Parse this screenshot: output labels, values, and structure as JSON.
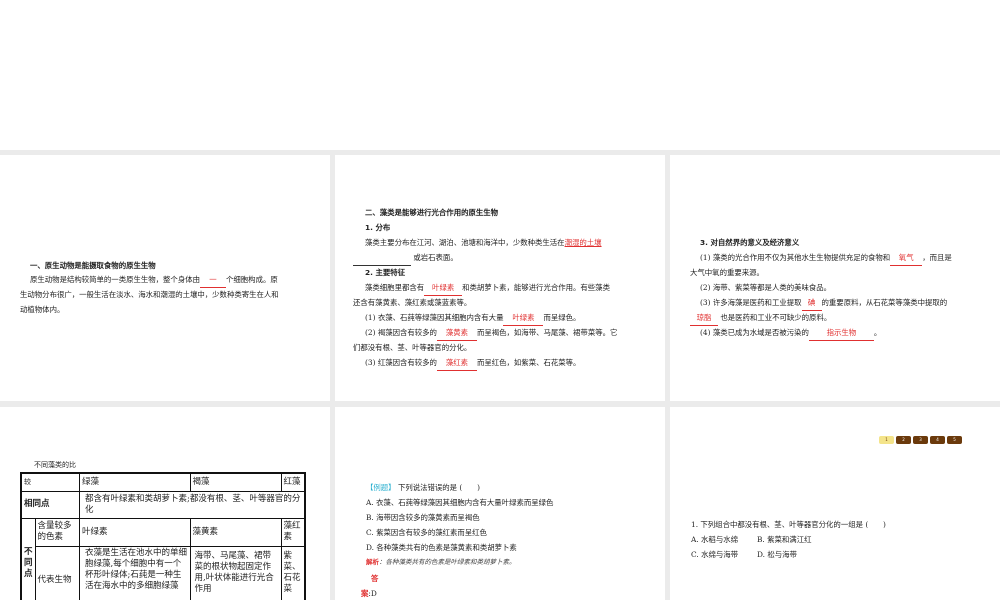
{
  "slide1": {
    "heading": "一、原生动物是能摄取食物的原生生物",
    "line1a": "原生动物是结构较简单的一类原生生物，整个身体由",
    "blank1": "一",
    "line1b": "个细胞构成。原",
    "line2": "生动物分布很广，一般生活在淡水、海水和潮湿的土壤中，少数种类寄生在人和",
    "line3": "动植物体内。"
  },
  "slide2": {
    "heading": "二、藻类是能够进行光合作用的原生生物",
    "sub1": "1. 分布",
    "p1a": "藻类主要分布在江河、湖泊、池塘和海洋中，少数种类生活在",
    "p1ans": "潮湿的土壤",
    "p1b": "或岩石表面。",
    "sub2": "2. 主要特征",
    "p2a": "藻类细胞里都含有",
    "p2ans": "叶绿素",
    "p2b": "和类胡萝卜素，能够进行光合作用。有些藻类",
    "p2c": "还含有藻黄素、藻红素或藻蓝素等。",
    "i1a": "(1) 衣藻、石莼等绿藻因其细胞内含有大量",
    "i1ans": "叶绿素",
    "i1b": "而呈绿色。",
    "i2a": "(2) 褐藻因含有较多的",
    "i2ans": "藻黄素",
    "i2b": "而呈褐色，如海带、马尾藻、裙带菜等。它",
    "i2c": "们都没有根、茎、叶等器官的分化。",
    "i3a": "(3) 红藻因含有较多的",
    "i3ans": "藻红素",
    "i3b": "而呈红色，如紫菜、石花菜等。"
  },
  "slide3": {
    "heading": "3. 对自然界的意义及经济意义",
    "i1a": "(1) 藻类的光合作用不仅为其他水生生物提供充足的食物和",
    "i1ans": "氧气",
    "i1b": "，而且是",
    "i1c": "大气中氧的重要来源。",
    "i2": "(2) 海带、紫菜等都是人类的美味食品。",
    "i3a": "(3) 许多海藻是医药和工业提取",
    "i3ans": "碘",
    "i3b": "的重要原料，从石花菜等藻类中提取的",
    "i3ans2": "琼脂",
    "i3c": "也是医药和工业不可缺少的原料。",
    "i4a": "(4) 藻类已成为水域是否被污染的",
    "i4ans": "指示生物",
    "i4b": "。"
  },
  "slide4": {
    "caption": "不同藻类的比",
    "table": {
      "h0": "较",
      "h1": "绿藻",
      "h2": "褐藻",
      "h3": "红藻",
      "same_label": "相同点",
      "same": "都含有叶绿素和类胡萝卜素;都没有根、茎、叶等器官的分化",
      "diff_label": "不同点",
      "pig_label": "含量较多的色素",
      "pig1": "叶绿素",
      "pig2": "藻黄素",
      "pig3": "藻红素",
      "rep_label": "代表生物",
      "rep1": "衣藻是生活在池水中的单细胞绿藻,每个细胞中有一个杯形叶绿体;石莼是一种生活在海水中的多细胞绿藻",
      "rep2": "海带、马尾藻、裙带菜的根状物起固定作用,叶状体能进行光合作用",
      "rep3": "紫菜、石花菜"
    }
  },
  "slide5": {
    "tag": "【例题】",
    "question": "下列说法错误的是 (　　)",
    "a": "A. 衣藻、石莼等绿藻因其细胞内含有大量叶绿素而呈绿色",
    "b": "B. 海带因含较多的藻黄素而呈褐色",
    "c": "C. 紫菜因含有较多的藻红素而呈红色",
    "d": "D. 各种藻类共有的色素是藻黄素和类胡萝卜素",
    "jx_label": "解析",
    "jx": "：各种藻类共有的色素是叶绿素和类胡萝卜素。",
    "ans_label1": "答",
    "ans_label2": "案",
    "ans": ":D"
  },
  "slide6": {
    "pages": [
      "1",
      "2",
      "3",
      "4",
      "5"
    ],
    "active_page": "1",
    "question": "1. 下列组合中都没有根、茎、叶等器官分化的一组是 (　　)",
    "a": "A. 水稻与水绵",
    "b": "B. 紫菜和满江红",
    "c": "C. 水绵与海带",
    "d": "D. 松与海带"
  },
  "colors": {
    "answer": "#e03030",
    "tag": "#2ab0d0",
    "page_active": "#f4e48a",
    "page": "#6b3a0c",
    "gap": "#ebebeb"
  }
}
